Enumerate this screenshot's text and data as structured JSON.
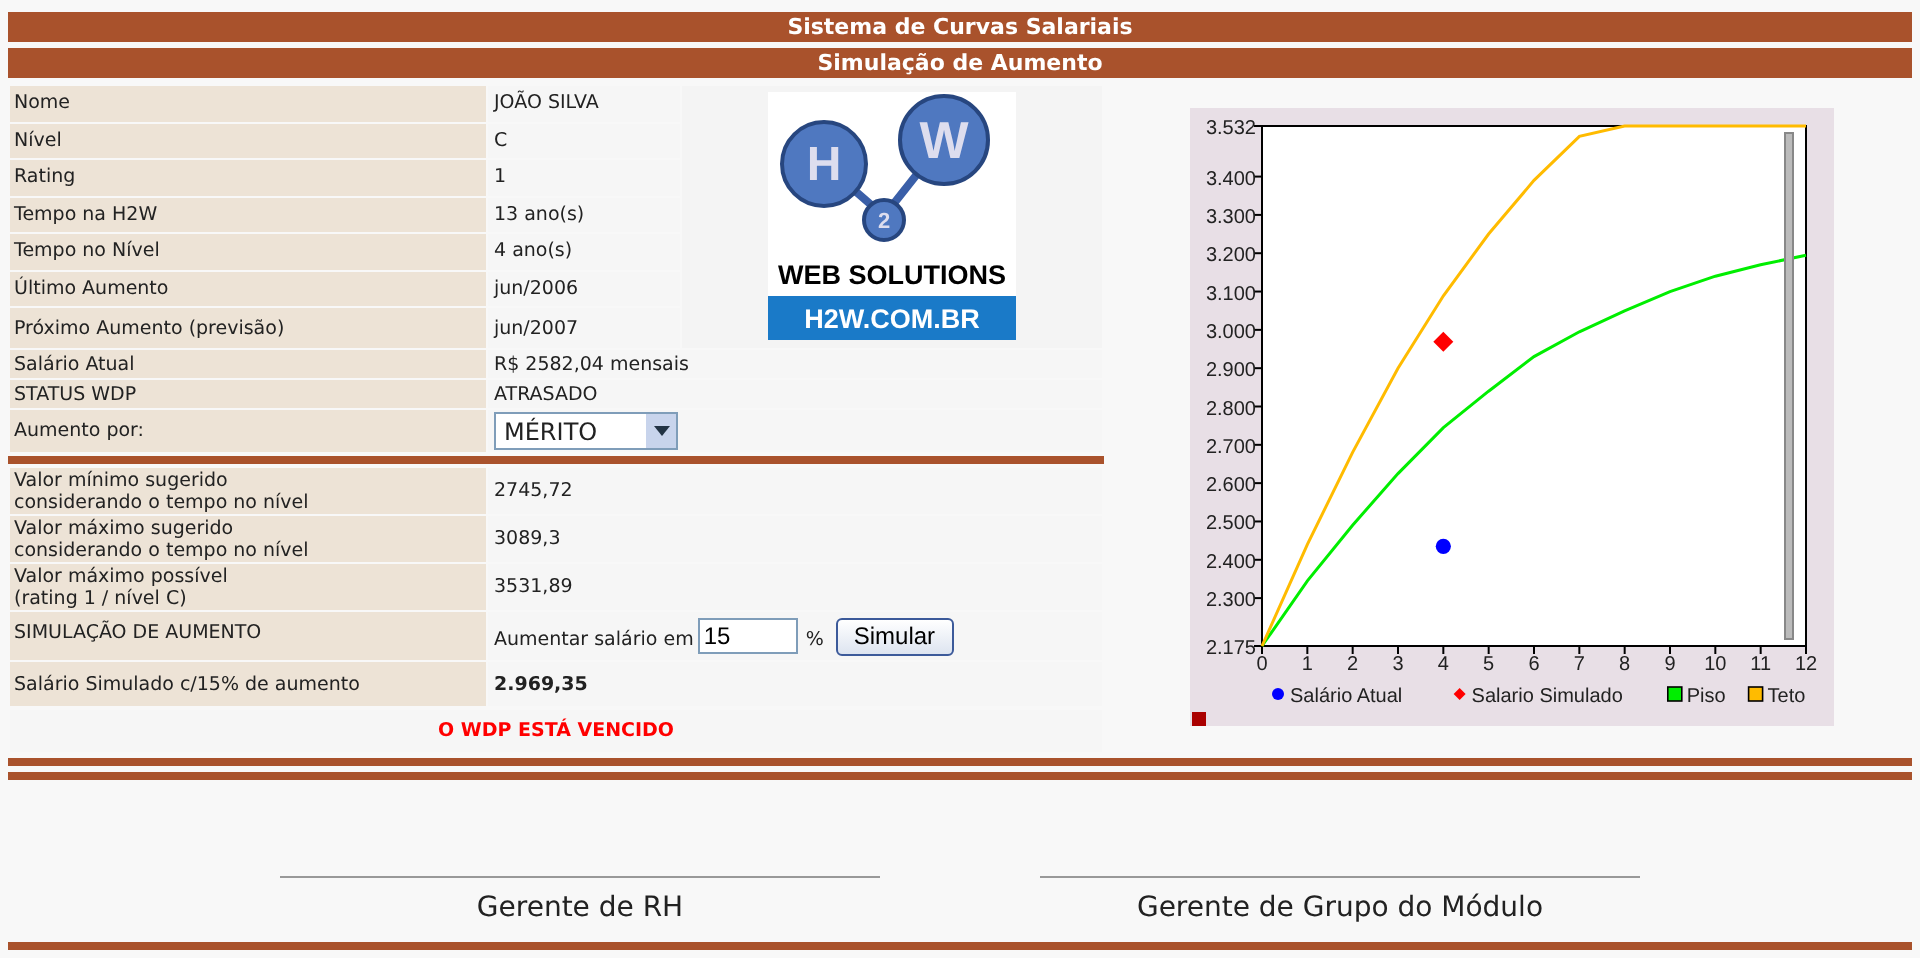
{
  "header": {
    "title": "Sistema de Curvas Salariais",
    "subtitle": "Simulação de Aumento"
  },
  "employee_fields": [
    {
      "label": "Nome",
      "value": "JOÃO SILVA"
    },
    {
      "label": "Nível",
      "value": "C"
    },
    {
      "label": "Rating",
      "value": "1"
    },
    {
      "label": "Tempo na H2W",
      "value": "13 ano(s)"
    },
    {
      "label": "Tempo no Nível",
      "value": "4 ano(s)"
    },
    {
      "label": "Último Aumento",
      "value": "jun/2006"
    },
    {
      "label": "Próximo Aumento (previsão)",
      "value": "jun/2007"
    },
    {
      "label": "Salário Atual",
      "value": "R$ 2582,04 mensais"
    },
    {
      "label": "STATUS WDP",
      "value": "ATRASADO"
    }
  ],
  "logo": {
    "letters": [
      "H",
      "2",
      "W"
    ],
    "tagline": "WEB SOLUTIONS",
    "site": "H2W.COM.BR"
  },
  "raise_by": {
    "label": "Aumento por:",
    "value": "MÉRITO"
  },
  "values": [
    {
      "label": "Valor mínimo sugerido\nconsiderando o tempo no nível",
      "value": "2745,72"
    },
    {
      "label": "Valor máximo sugerido\nconsiderando o tempo no nível",
      "value": "3089,3"
    },
    {
      "label": "Valor máximo possível\n(rating 1 / nível C)",
      "value": "3531,89"
    }
  ],
  "simulation": {
    "label": "SIMULAÇÃO DE AUMENTO",
    "prefix": "Aumentar salário em",
    "input_value": "15",
    "unit": "%",
    "button": "Simular"
  },
  "result": {
    "label": "Salário Simulado c/15% de aumento",
    "value": "2.969,35"
  },
  "warning": "O WDP ESTÁ VENCIDO",
  "chart": {
    "chart_data": {
      "type": "line",
      "x": [
        0,
        1,
        2,
        3,
        4,
        5,
        6,
        7,
        8,
        9,
        10,
        11,
        12
      ],
      "xlim": [
        0,
        12
      ],
      "ylim": [
        2175,
        3532
      ],
      "legend": "bottom",
      "xticks": [
        0,
        1,
        2,
        3,
        4,
        5,
        6,
        7,
        8,
        9,
        10,
        11,
        12
      ],
      "yticks": [
        {
          "value": 2175,
          "label": "2.175"
        },
        {
          "value": 2300,
          "label": "2.300"
        },
        {
          "value": 2400,
          "label": "2.400"
        },
        {
          "value": 2500,
          "label": "2.500"
        },
        {
          "value": 2600,
          "label": "2.600"
        },
        {
          "value": 2700,
          "label": "2.700"
        },
        {
          "value": 2800,
          "label": "2.800"
        },
        {
          "value": 2900,
          "label": "2.900"
        },
        {
          "value": 3000,
          "label": "3.000"
        },
        {
          "value": 3100,
          "label": "3.100"
        },
        {
          "value": 3200,
          "label": "3.200"
        },
        {
          "value": 3300,
          "label": "3.300"
        },
        {
          "value": 3400,
          "label": "3.400"
        },
        {
          "value": 3532,
          "label": "3.532"
        }
      ],
      "series": [
        {
          "name": "Salário Atual",
          "color": "#0000ff",
          "marker": "circle",
          "values": [
            null,
            null,
            null,
            null,
            2435,
            null,
            null,
            null,
            null,
            null,
            null,
            null,
            null
          ]
        },
        {
          "name": "Salario Simulado",
          "color": "#ff0000",
          "marker": "diamond",
          "values": [
            null,
            null,
            null,
            null,
            2969,
            null,
            null,
            null,
            null,
            null,
            null,
            null,
            null
          ]
        },
        {
          "name": "Piso",
          "color": "#00ee00",
          "values": [
            2175,
            2345,
            2490,
            2625,
            2745,
            2840,
            2930,
            2995,
            3050,
            3100,
            3140,
            3170,
            3195
          ]
        },
        {
          "name": "Teto",
          "color": "#ffbb00",
          "values": [
            2175,
            2440,
            2680,
            2900,
            3089,
            3250,
            3390,
            3505,
            3532,
            3532,
            3532,
            3532,
            3532
          ]
        }
      ]
    }
  },
  "signatures": [
    "Gerente de RH",
    "Gerente de Grupo do Módulo"
  ]
}
